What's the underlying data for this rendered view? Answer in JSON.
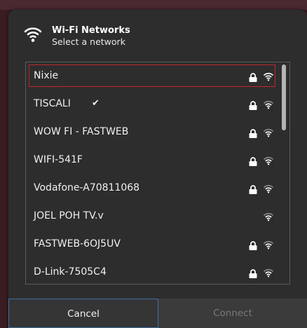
{
  "header": {
    "title": "Wi-Fi Networks",
    "subtitle": "Select a network",
    "icon": "wifi-icon"
  },
  "networks": [
    {
      "name": "Nixie",
      "secured": true,
      "connected": false,
      "selected": true
    },
    {
      "name": "TISCALI",
      "secured": true,
      "connected": true,
      "selected": false
    },
    {
      "name": "WOW FI - FASTWEB",
      "secured": true,
      "connected": false,
      "selected": false
    },
    {
      "name": "WIFI-541F",
      "secured": true,
      "connected": false,
      "selected": false
    },
    {
      "name": "Vodafone-A70811068",
      "secured": true,
      "connected": false,
      "selected": false
    },
    {
      "name": "JOEL POH TV.v",
      "secured": false,
      "connected": false,
      "selected": false
    },
    {
      "name": "FASTWEB-6OJ5UV",
      "secured": true,
      "connected": false,
      "selected": false
    },
    {
      "name": "D-Link-7505C4",
      "secured": true,
      "connected": false,
      "selected": false
    }
  ],
  "connected_mark": "✔",
  "buttons": {
    "cancel_label": "Cancel",
    "connect_label": "Connect"
  },
  "colors": {
    "selection_border": "#c1272d",
    "cancel_border": "#3d6fa3",
    "dialog_bg": "#2d2d2d"
  }
}
